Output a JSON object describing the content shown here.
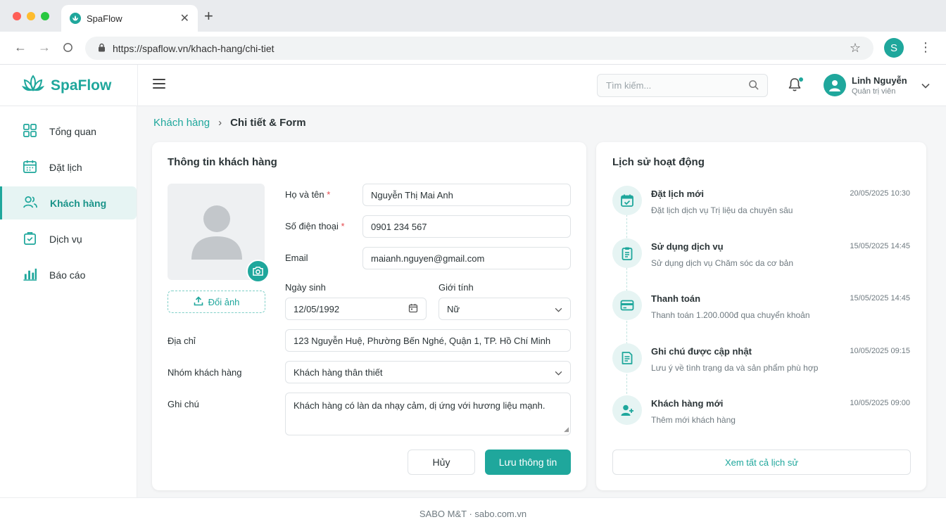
{
  "browser": {
    "tab_title": "SpaFlow",
    "url": "https://spaflow.vn/khach-hang/chi-tiet",
    "profile_initial": "S"
  },
  "header": {
    "brand": "SpaFlow",
    "search_placeholder": "Tìm kiếm...",
    "user_name": "Linh Nguyễn",
    "user_role": "Quản trị viên"
  },
  "sidebar": {
    "items": [
      {
        "label": "Tổng quan",
        "icon": "dashboard-icon"
      },
      {
        "label": "Đặt lịch",
        "icon": "calendar-icon"
      },
      {
        "label": "Khách hàng",
        "icon": "users-icon",
        "active": true
      },
      {
        "label": "Dịch vụ",
        "icon": "service-icon"
      },
      {
        "label": "Báo cáo",
        "icon": "bar-chart-icon"
      }
    ]
  },
  "breadcrumb": {
    "parent": "Khách hàng",
    "current": "Chi tiết & Form"
  },
  "form": {
    "title": "Thông tin khách hàng",
    "upload_label": "Đổi ảnh",
    "name_label": "Họ và tên",
    "name_value": "Nguyễn Thị Mai Anh",
    "phone_label": "Số điện thoại",
    "phone_value": "0901 234 567",
    "email_label": "Email",
    "email_value": "maianh.nguyen@gmail.com",
    "dob_label": "Ngày sinh",
    "dob_value": "12/05/1992",
    "gender_label": "Giới tính",
    "gender_value": "Nữ",
    "address_label": "Địa chỉ",
    "address_value": "123 Nguyễn Huệ, Phường Bến Nghé, Quận 1, TP. Hồ Chí Minh",
    "group_label": "Nhóm khách hàng",
    "group_value": "Khách hàng thân thiết",
    "note_label": "Ghi chú",
    "note_value": "Khách hàng có làn da nhạy cảm, dị ứng với hương liệu mạnh.",
    "required_mark": "*",
    "cancel_label": "Hủy",
    "save_label": "Lưu thông tin"
  },
  "history": {
    "title": "Lịch sử hoạt động",
    "items": [
      {
        "title": "Đặt lịch mới",
        "desc": "Đặt lịch dịch vụ Trị liệu da chuyên sâu",
        "time": "20/05/2025 10:30",
        "icon": "calendar-check-icon"
      },
      {
        "title": "Sử dụng dịch vụ",
        "desc": "Sử dụng dịch vụ Chăm sóc da cơ bản",
        "time": "15/05/2025 14:45",
        "icon": "clipboard-icon"
      },
      {
        "title": "Thanh toán",
        "desc": "Thanh toán 1.200.000đ qua chuyển khoản",
        "time": "15/05/2025 14:45",
        "icon": "credit-card-icon"
      },
      {
        "title": "Ghi chú được cập nhật",
        "desc": "Lưu ý về tình trạng da và sản phẩm phù hợp",
        "time": "10/05/2025 09:15",
        "icon": "note-icon"
      },
      {
        "title": "Khách hàng mới",
        "desc": "Thêm mới khách hàng",
        "time": "10/05/2025 09:00",
        "icon": "user-plus-icon"
      }
    ],
    "view_all_label": "Xem tất cả lịch sử"
  },
  "footer": {
    "text": "SABO M&T · sabo.com.vn"
  },
  "colors": {
    "accent": "#1fa79c",
    "accent_light": "#e6f4f3",
    "required": "#e5484d"
  }
}
